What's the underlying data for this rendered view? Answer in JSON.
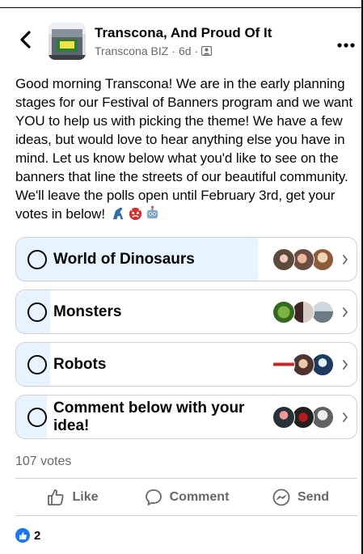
{
  "header": {
    "group_name": "Transcona, And Proud Of It",
    "author": "Transcona BIZ",
    "time": "6d",
    "separator": "·",
    "icons": {
      "back": "chevron-left-icon",
      "more": "more-horizontal-icon",
      "privacy": "group-privacy-icon"
    }
  },
  "post": {
    "text": "Good morning Transcona! We are in the early planning stages for our Festival of Banners program and we want YOU to help us with picking the theme! We have a few ideas, but would love to hear anything else you have in mind. Let us know below what you'd like to see on the banners that line the streets of our beautiful community. We'll leave the polls open until February 3rd, get your votes in below!",
    "emojis": [
      "dinosaur-emoji",
      "ogre-emoji",
      "robot-emoji"
    ]
  },
  "poll": {
    "options": [
      {
        "label": "World of Dinosaurs",
        "share": 0.71
      },
      {
        "label": "Monsters",
        "share": 0.1
      },
      {
        "label": "Robots",
        "share": 0.1
      },
      {
        "label": "Comment below with your idea!",
        "share": 0.09
      }
    ],
    "votes_label": "107 votes"
  },
  "actions": {
    "like": "Like",
    "comment": "Comment",
    "send": "Send"
  },
  "reactions": {
    "count": "2"
  },
  "colors": {
    "accent": "#1877f2",
    "fill": "#e7f3ff",
    "muted": "#65676b",
    "border": "#ced0d4"
  }
}
